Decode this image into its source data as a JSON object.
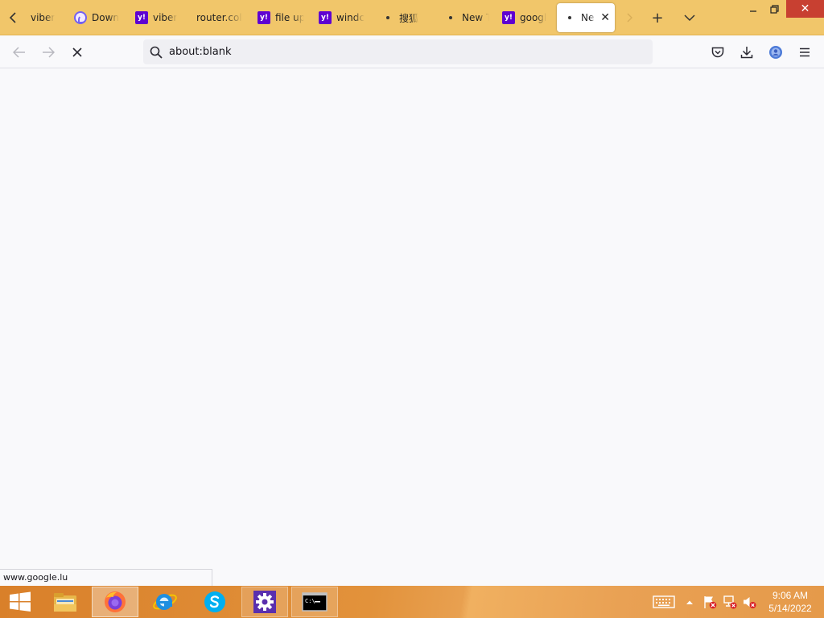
{
  "browser": {
    "tabs": [
      {
        "title": "viber",
        "favicon": "none"
      },
      {
        "title": "Down",
        "favicon": "viber-icon"
      },
      {
        "title": "viber",
        "favicon": "yahoo-icon"
      },
      {
        "title": "router.coll",
        "favicon": "none"
      },
      {
        "title": "file up",
        "favicon": "yahoo-icon"
      },
      {
        "title": "windc",
        "favicon": "yahoo-icon"
      },
      {
        "title": "搜狐",
        "favicon": "dot-icon"
      },
      {
        "title": "New T",
        "favicon": "dot-icon"
      },
      {
        "title": "googl",
        "favicon": "yahoo-icon"
      },
      {
        "title": "Ne",
        "favicon": "dot-icon",
        "active": true
      }
    ],
    "yahoo_glyph": "y!",
    "new_tab_symbol": "+",
    "url": "about:blank",
    "status_link": "www.google.lu"
  },
  "colors": {
    "tabstrip": "#f1c66a",
    "window_close": "#c84031",
    "yahoo_purple": "#5f01d1"
  },
  "taskbar": {
    "clock_time": "9:06 AM",
    "clock_date": "5/14/2022",
    "apps": [
      "start-icon",
      "file-explorer-icon",
      "firefox-icon",
      "internet-explorer-icon",
      "skype-icon",
      "settings-icon",
      "command-prompt-icon"
    ],
    "cmd_glyph": "C:\\"
  }
}
